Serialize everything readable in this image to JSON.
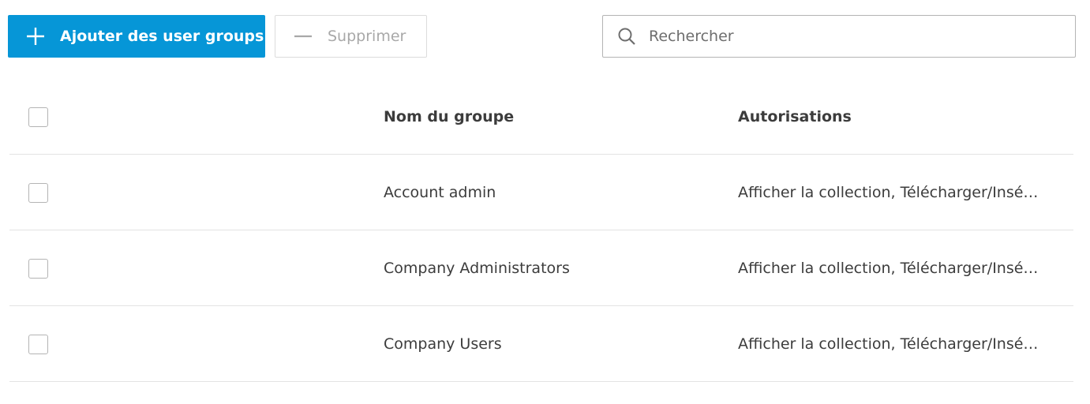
{
  "toolbar": {
    "add_label": "Ajouter des user groups",
    "remove_label": "Supprimer",
    "add_icon": "plus-icon",
    "remove_icon": "minus-icon"
  },
  "search": {
    "placeholder": "Rechercher",
    "icon": "search-icon"
  },
  "table": {
    "columns": {
      "name": "Nom du groupe",
      "permissions": "Autorisations"
    },
    "rows": [
      {
        "name": "Account admin",
        "permissions": "Afficher la collection, Télécharger/Insé…"
      },
      {
        "name": "Company Administrators",
        "permissions": "Afficher la collection, Télécharger/Insé…"
      },
      {
        "name": "Company Users",
        "permissions": "Afficher la collection, Télécharger/Insé…"
      }
    ]
  },
  "colors": {
    "accent": "#0696d7",
    "border": "#dcdcdc",
    "row_divider": "#e3e3e3"
  }
}
